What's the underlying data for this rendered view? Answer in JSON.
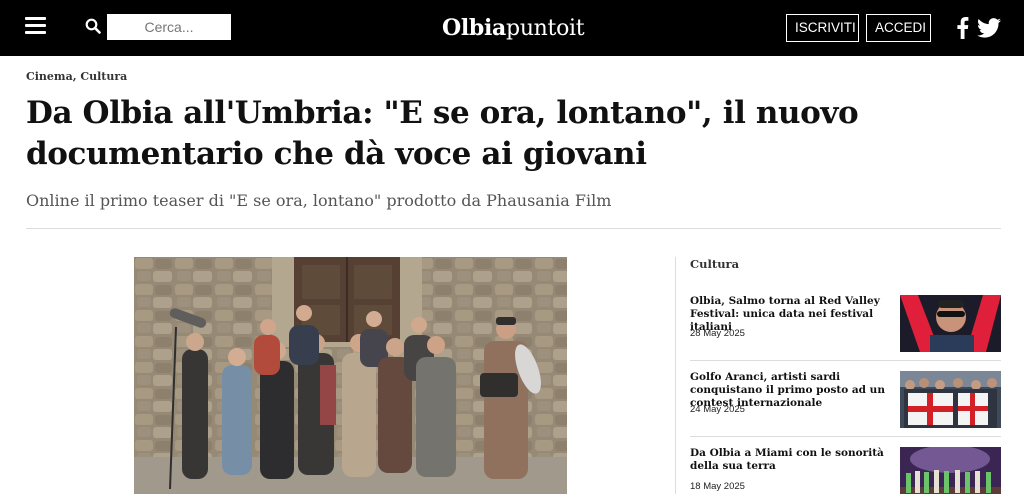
{
  "header": {
    "search_placeholder": "Cerca...",
    "logo_bold": "Olbia",
    "logo_light": "puntoit",
    "subscribe_label": "ISCRIVITI",
    "login_label": "ACCEDI",
    "icons": [
      "menu-icon",
      "search-icon",
      "facebook-icon",
      "twitter-icon"
    ]
  },
  "article": {
    "categories": "Cinema, Cultura",
    "title": "Da Olbia all'Umbria: \"E se ora, lontano\", il nuovo documentario che dà voce ai giovani",
    "subtitle": "Online il primo teaser di \"E se ora, lontano\" prodotto da Phausania Film"
  },
  "sidebar": {
    "section_title": "Cultura",
    "items": [
      {
        "title": "Olbia, Salmo torna al Red Valley Festival: unica data nei festival italiani",
        "date": "28 May 2025"
      },
      {
        "title": "Golfo Aranci, artisti sardi conquistano il primo posto ad un contest internazionale",
        "date": "24 May 2025"
      },
      {
        "title": "Da Olbia a Miami con le sonorità della sua terra",
        "date": "18 May 2025"
      }
    ]
  },
  "colors": {
    "header_bg": "#000000",
    "text": "#111111",
    "subtitle": "#555555",
    "divider": "#dddddd"
  }
}
